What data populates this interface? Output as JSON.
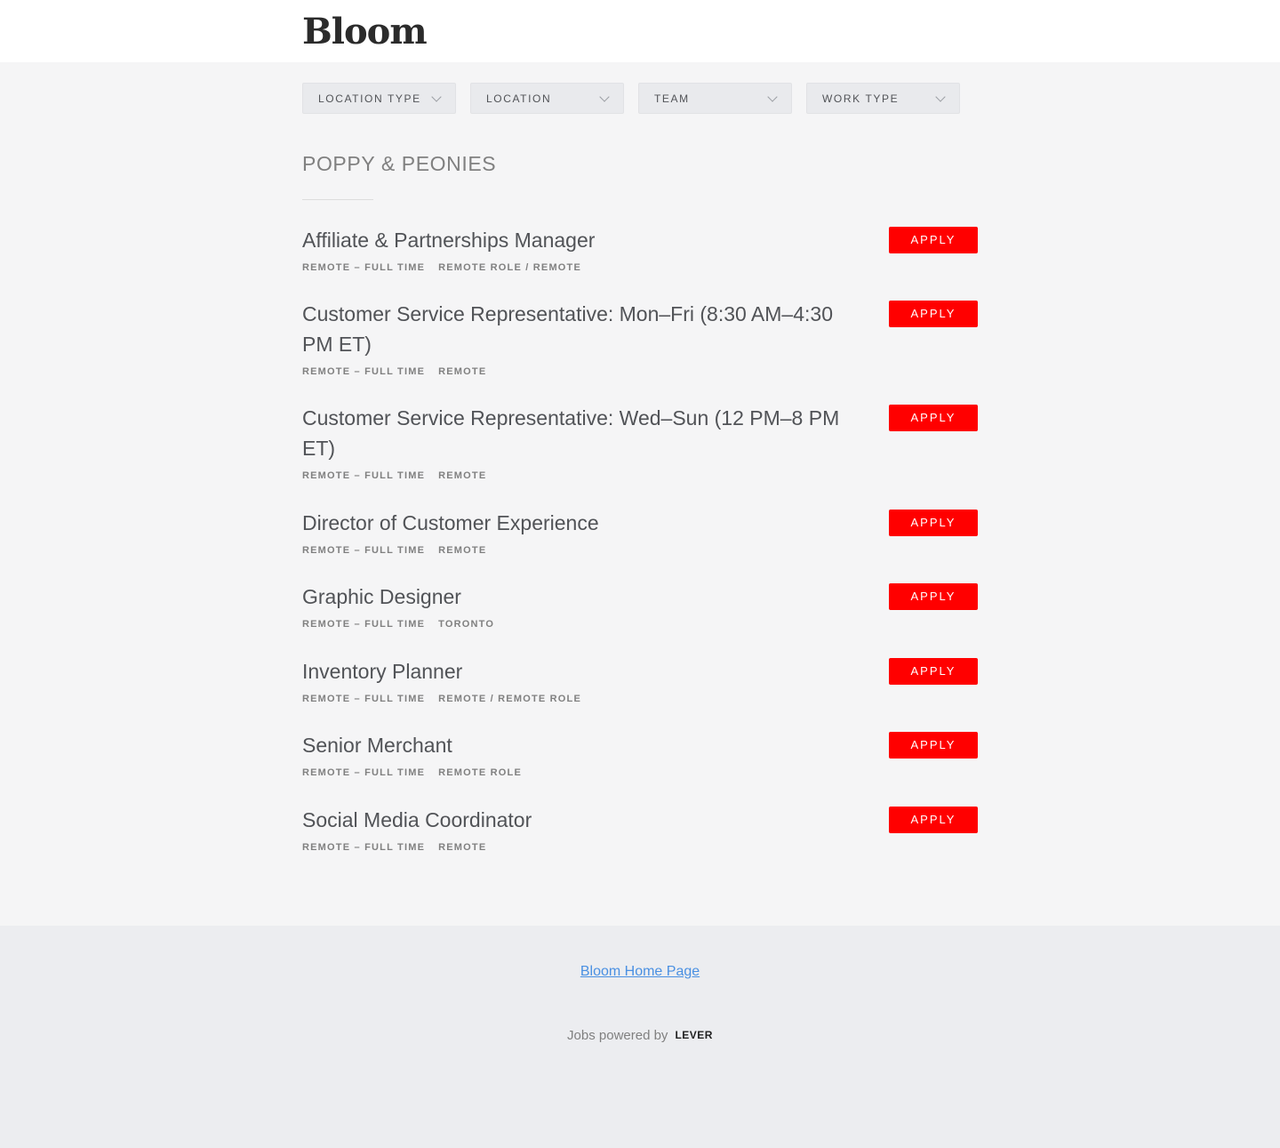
{
  "header": {
    "logo": "Bloom"
  },
  "filters": [
    {
      "label": "LOCATION TYPE"
    },
    {
      "label": "LOCATION"
    },
    {
      "label": "TEAM"
    },
    {
      "label": "WORK TYPE"
    }
  ],
  "section": {
    "title": "POPPY & PEONIES"
  },
  "apply_label": "APPLY",
  "postings": [
    {
      "title": "Affiliate & Partnerships Manager",
      "commitment": "REMOTE – FULL TIME",
      "location": "REMOTE ROLE / REMOTE"
    },
    {
      "title": "Customer Service Representative: Mon–Fri (8:30 AM–4:30 PM ET)",
      "commitment": "REMOTE – FULL TIME",
      "location": "REMOTE"
    },
    {
      "title": "Customer Service Representative: Wed–Sun (12 PM–8 PM ET)",
      "commitment": "REMOTE – FULL TIME",
      "location": "REMOTE"
    },
    {
      "title": "Director of Customer Experience",
      "commitment": "REMOTE – FULL TIME",
      "location": "REMOTE"
    },
    {
      "title": "Graphic Designer",
      "commitment": "REMOTE – FULL TIME",
      "location": "TORONTO"
    },
    {
      "title": "Inventory Planner",
      "commitment": "REMOTE – FULL TIME",
      "location": "REMOTE / REMOTE ROLE"
    },
    {
      "title": "Senior Merchant",
      "commitment": "REMOTE – FULL TIME",
      "location": "REMOTE ROLE"
    },
    {
      "title": "Social Media Coordinator",
      "commitment": "REMOTE – FULL TIME",
      "location": "REMOTE"
    }
  ],
  "footer": {
    "home_link": "Bloom Home Page",
    "powered_by": "Jobs powered by",
    "lever_logo": "LEVER"
  },
  "colors": {
    "apply_button": "#ff0000",
    "link": "#4a90e2"
  }
}
